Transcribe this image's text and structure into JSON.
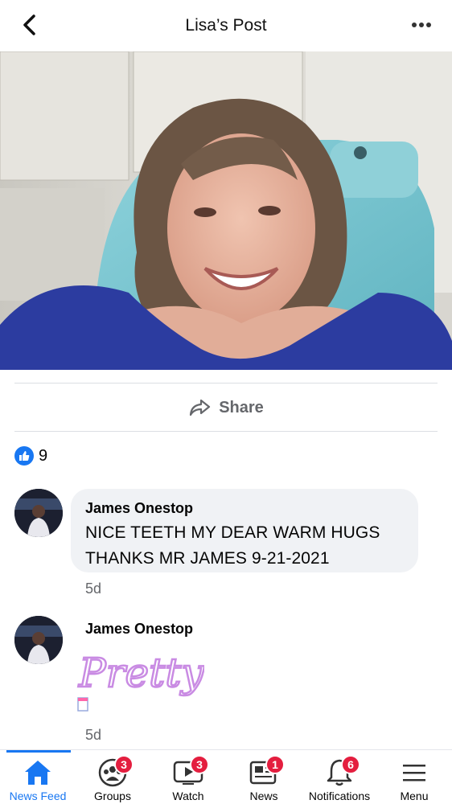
{
  "header": {
    "title": "Lisa’s Post"
  },
  "post": {
    "share_label": "Share",
    "reaction_count": "9"
  },
  "comments": [
    {
      "author": "James Onestop",
      "text_line1": "NICE TEETH MY DEAR WARM HUGS",
      "text_line2": "THANKS MR JAMES 9-21-2021",
      "time": "5d"
    },
    {
      "author": "James Onestop",
      "sticker_text": "Pretty",
      "time": "5d"
    }
  ],
  "tabbar": {
    "tabs": [
      {
        "label": "News Feed",
        "badge": ""
      },
      {
        "label": "Groups",
        "badge": "3"
      },
      {
        "label": "Watch",
        "badge": "3"
      },
      {
        "label": "News",
        "badge": "1"
      },
      {
        "label": "Notifications",
        "badge": "6"
      },
      {
        "label": "Menu",
        "badge": ""
      }
    ],
    "active": "News Feed"
  },
  "colors": {
    "accent": "#1877f2",
    "badge": "#e41e3f",
    "chair": "#7fc7d1",
    "shirt": "#2c3ca0",
    "sticker": "#c98be3"
  }
}
